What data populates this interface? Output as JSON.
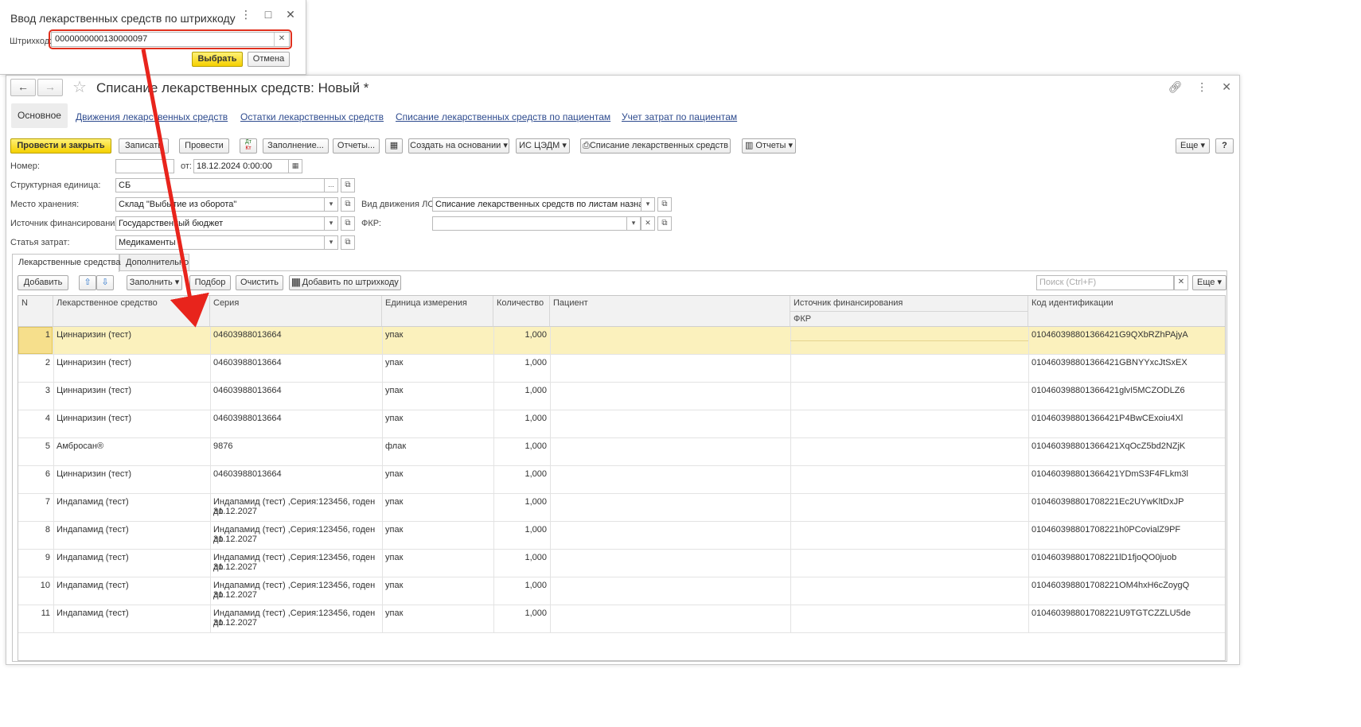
{
  "dialog": {
    "title": "Ввод лекарственных средств по штрихкоду",
    "barcode_label": "Штрихкод:",
    "barcode_value": "0000000000130000097",
    "select_label": "Выбрать",
    "cancel_label": "Отмена"
  },
  "form": {
    "title": "Списание лекарственных средств: Новый *",
    "tabs": [
      "Основное",
      "Движения лекарственных средств",
      "Остатки лекарственных средств",
      "Списание лекарственных средств по пациентам",
      "Учет затрат по пациентам"
    ],
    "toolbar": {
      "post_close": "Провести и закрыть",
      "write": "Записать",
      "post": "Провести",
      "dt_kt": "Дт Кт",
      "fill": "Заполнение...",
      "reports_dots": "Отчеты...",
      "create_based": "Создать на основании",
      "is_csedm": "ИС ЦЭДМ",
      "writeoff_print": "Списание лекарственных средств",
      "reports": "Отчеты",
      "more": "Еще",
      "help": "?"
    },
    "fields": {
      "number_label": "Номер:",
      "number_value": "",
      "date_label": "от:",
      "date_value": "18.12.2024  0:00:00",
      "unit_label": "Структурная единица:",
      "unit_value": "СБ",
      "storage_label": "Место хранения:",
      "storage_value": "Склад \"Выбытие из оборота\"",
      "movement_label": "Вид движения ЛС:",
      "movement_value": "Списание лекарственных средств по листам назначени",
      "source_label": "Источник финансирования:",
      "source_value": "Государственный бюджет",
      "fkr_label": "ФКР:",
      "fkr_value": "",
      "cost_label": "Статья затрат:",
      "cost_value": "Медикаменты"
    },
    "inner_tabs": [
      "Лекарственные средства",
      "Дополнительно"
    ],
    "grid_toolbar": {
      "add": "Добавить",
      "fill": "Заполнить",
      "pick": "Подбор",
      "clear": "Очистить",
      "add_barcode": "Добавить по штрихкоду",
      "search_placeholder": "Поиск (Ctrl+F)",
      "more": "Еще"
    },
    "columns": {
      "n": "N",
      "drug": "Лекарственное средство",
      "series": "Серия",
      "unit": "Единица измерения",
      "qty": "Количество",
      "patient": "Пациент",
      "source": "Источник финансирования",
      "fkr": "ФКР",
      "code": "Код идентификации"
    },
    "rows": [
      {
        "n": "1",
        "drug": "Циннаризин (тест)",
        "series": "04603988013664",
        "series2": "",
        "unit": "упак",
        "qty": "1,000",
        "code": "010460398801366421G9QXbRZhPAjyA"
      },
      {
        "n": "2",
        "drug": "Циннаризин (тест)",
        "series": "04603988013664",
        "series2": "",
        "unit": "упак",
        "qty": "1,000",
        "code": "010460398801366421GBNYYxcJtSxEX"
      },
      {
        "n": "3",
        "drug": "Циннаризин (тест)",
        "series": "04603988013664",
        "series2": "",
        "unit": "упак",
        "qty": "1,000",
        "code": "010460398801366421glvI5MCZODLZ6"
      },
      {
        "n": "4",
        "drug": "Циннаризин (тест)",
        "series": "04603988013664",
        "series2": "",
        "unit": "упак",
        "qty": "1,000",
        "code": "010460398801366421P4BwCExoiu4Xl"
      },
      {
        "n": "5",
        "drug": "Амбросан®",
        "series": "9876",
        "series2": "",
        "unit": "флак",
        "qty": "1,000",
        "code": "010460398801366421XqOcZ5bd2NZjK"
      },
      {
        "n": "6",
        "drug": "Циннаризин (тест)",
        "series": "04603988013664",
        "series2": "",
        "unit": "упак",
        "qty": "1,000",
        "code": "010460398801366421YDmS3F4FLkm3l"
      },
      {
        "n": "7",
        "drug": "Индапамид (тест)",
        "series": "Индапамид (тест) ,Серия:123456, годен до",
        "series2": "31.12.2027",
        "unit": "упак",
        "qty": "1,000",
        "code": "010460398801708221Ec2UYwKltDxJP"
      },
      {
        "n": "8",
        "drug": "Индапамид (тест)",
        "series": "Индапамид (тест) ,Серия:123456, годен до",
        "series2": "31.12.2027",
        "unit": "упак",
        "qty": "1,000",
        "code": "010460398801708221h0PCovialZ9PF"
      },
      {
        "n": "9",
        "drug": "Индапамид (тест)",
        "series": "Индапамид (тест) ,Серия:123456, годен до",
        "series2": "31.12.2027",
        "unit": "упак",
        "qty": "1,000",
        "code": "010460398801708221lD1fjoQO0juob"
      },
      {
        "n": "10",
        "drug": "Индапамид (тест)",
        "series": "Индапамид (тест) ,Серия:123456, годен до",
        "series2": "31.12.2027",
        "unit": "упак",
        "qty": "1,000",
        "code": "010460398801708221OM4hxH6cZoygQ"
      },
      {
        "n": "11",
        "drug": "Индапамид (тест)",
        "series": "Индапамид (тест) ,Серия:123456, годен до",
        "series2": "31.12.2027",
        "unit": "упак",
        "qty": "1,000",
        "code": "010460398801708221U9TGTCZZLU5de"
      }
    ]
  },
  "colors": {
    "accent_yellow": "#f5d000",
    "selection_row": "#fbf1bd",
    "annotation_red": "#e0301e",
    "link": "#2f4c8f"
  }
}
